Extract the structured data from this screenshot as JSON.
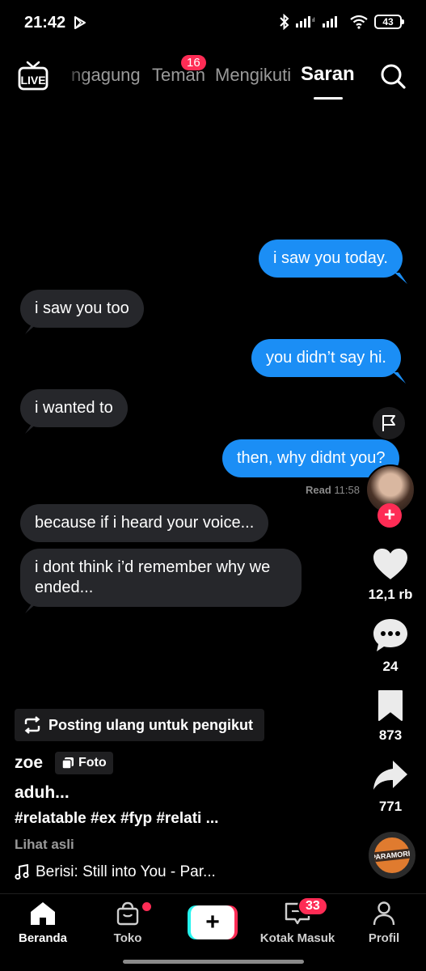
{
  "status_bar": {
    "time": "21:42",
    "battery": "43"
  },
  "top_nav": {
    "live_label": "LIVE",
    "tabs": [
      {
        "label": "ngagung"
      },
      {
        "label": "Teman"
      },
      {
        "label": "Mengikuti"
      },
      {
        "label": "Saran"
      }
    ],
    "teman_badge": "16",
    "active_tab": "Saran"
  },
  "chat": {
    "messages": [
      {
        "from": "me",
        "text": "i saw you today."
      },
      {
        "from": "them",
        "text": "i saw you too"
      },
      {
        "from": "me",
        "text": "you didn’t say hi."
      },
      {
        "from": "them",
        "text": "i wanted to"
      },
      {
        "from": "me",
        "text": "then, why didnt you?"
      },
      {
        "from": "them",
        "text": "because if i heard your voice..."
      },
      {
        "from": "them",
        "text": "i dont think i’d remember why we ended..."
      }
    ],
    "read_label": "Read",
    "read_time": "11:58"
  },
  "rail": {
    "likes": "12,1 rb",
    "comments": "24",
    "bookmarks": "873",
    "shares": "771"
  },
  "caption": {
    "repost_label": "Posting ulang untuk pengikut",
    "author": "zoe",
    "content_type": "Foto",
    "title": "aduh...",
    "hashtags": "#relatable #ex #fyp #relati ...",
    "see_original": "Lihat asli",
    "music": "Berisi: Still into You - Par..."
  },
  "music_disc_text": "PARAMORE",
  "bottom_nav": {
    "home": "Beranda",
    "shop": "Toko",
    "inbox": "Kotak Masuk",
    "inbox_badge": "33",
    "profile": "Profil"
  },
  "colors": {
    "accent": "#fe2c55",
    "outgoing_bubble": "#1b8ef5",
    "incoming_bubble": "#26272b",
    "background": "#000000"
  }
}
